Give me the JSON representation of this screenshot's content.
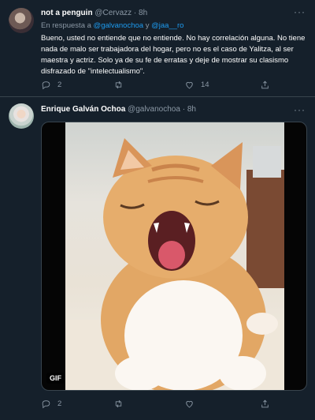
{
  "tweet1": {
    "name": "not a penguin",
    "handle": "@Cervazz",
    "sep": " · ",
    "time": "8h",
    "reply_prefix": "En respuesta a ",
    "mention1": "@galvanochoa",
    "reply_and": " y ",
    "mention2": "@jaa__ro",
    "text": "Bueno, usted no entiende que no entiende. No hay correlación alguna. No tiene nada de malo ser trabajadora del hogar, pero no es el caso de Yalitza, al ser maestra y actriz. Solo ya de su fe de erratas y deje de mostrar su clasismo disfrazado de \"intelectualismo\".",
    "reply_count": "2",
    "retweet_count": "",
    "like_count": "14",
    "more": "···"
  },
  "tweet2": {
    "name": "Enrique Galván Ochoa",
    "handle": "@galvanochoa",
    "sep": " · ",
    "time": "8h",
    "more": "···",
    "media_badge": "GIF",
    "reply_count": "2",
    "retweet_count": "",
    "like_count": ""
  },
  "colors": {
    "background": "#15202b",
    "text_secondary": "#8b98a5",
    "link": "#1d9bf0",
    "divider": "#38444d"
  },
  "icons": [
    "reply-icon",
    "retweet-icon",
    "like-icon",
    "share-icon",
    "more-icon"
  ]
}
